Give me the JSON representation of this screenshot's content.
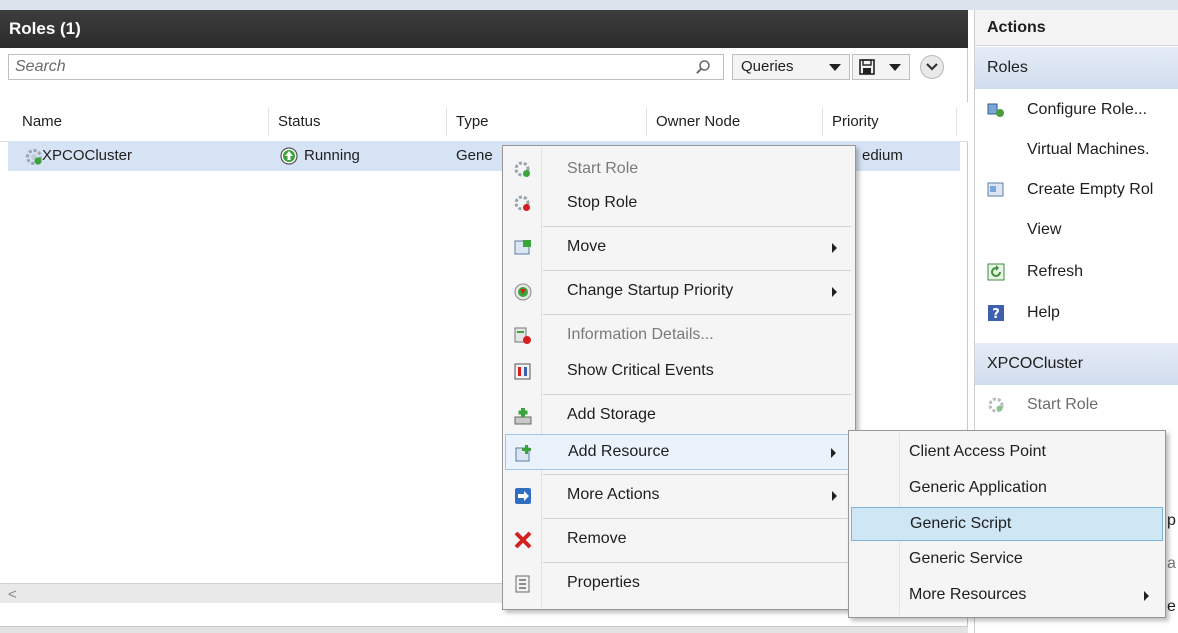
{
  "roles_pane": {
    "title": "Roles (1)",
    "search": {
      "placeholder": "Search",
      "value": ""
    },
    "queries_label": "Queries",
    "columns": [
      "Name",
      "Status",
      "Type",
      "Owner Node",
      "Priority"
    ],
    "rows": [
      {
        "name": "XPCOCluster",
        "status": "Running",
        "type_visible": "Gene",
        "priority_visible": "edium"
      }
    ],
    "scroll_left_glyph": "<"
  },
  "actions_pane": {
    "title": "Actions",
    "sections": [
      {
        "title": "Roles",
        "items": [
          {
            "label": "Configure Role...",
            "icon": "configure-role-icon"
          },
          {
            "label": "Virtual Machines.",
            "icon": ""
          },
          {
            "label": "Create Empty Rol",
            "icon": "create-empty-role-icon"
          },
          {
            "label": "View",
            "icon": ""
          },
          {
            "label": "Refresh",
            "icon": "refresh-icon"
          },
          {
            "label": "Help",
            "icon": "help-icon"
          }
        ]
      },
      {
        "title": "XPCOCluster",
        "items": [
          {
            "label": "Start Role",
            "icon": "start-role-icon",
            "disabled": true
          }
        ]
      }
    ],
    "peek_letters": [
      "p",
      "a",
      "e"
    ]
  },
  "context_menu": {
    "items": [
      {
        "label": "Start Role",
        "icon": "start-role-icon",
        "disabled": true
      },
      {
        "label": "Stop Role",
        "icon": "stop-role-icon"
      },
      {
        "label": "Move",
        "icon": "move-icon",
        "submenu": true
      },
      {
        "label": "Change Startup Priority",
        "icon": "startup-priority-icon",
        "submenu": true
      },
      {
        "label": "Information Details...",
        "icon": "information-details-icon",
        "disabled": true
      },
      {
        "label": "Show Critical Events",
        "icon": "critical-events-icon"
      },
      {
        "label": "Add Storage",
        "icon": "add-storage-icon"
      },
      {
        "label": "Add Resource",
        "icon": "add-resource-icon",
        "submenu": true,
        "highlighted": true
      },
      {
        "label": "More Actions",
        "icon": "more-actions-icon",
        "submenu": true
      },
      {
        "label": "Remove",
        "icon": "remove-icon"
      },
      {
        "label": "Properties",
        "icon": "properties-icon"
      }
    ]
  },
  "submenu": {
    "items": [
      {
        "label": "Client Access Point"
      },
      {
        "label": "Generic Application"
      },
      {
        "label": "Generic Script",
        "highlighted": true
      },
      {
        "label": "Generic Service"
      },
      {
        "label": "More Resources",
        "submenu": true
      }
    ]
  },
  "colors": {
    "header_bg": "#2b2b2b",
    "row_selected": "#d6e3f4",
    "menu_bg": "#f5f5f5",
    "menu_highlight": "#eaf3fc",
    "submenu_highlight": "#cfe6f5",
    "section_bg": "#d1ddee",
    "running_green": "#3aa43a",
    "remove_red": "#d42020"
  }
}
